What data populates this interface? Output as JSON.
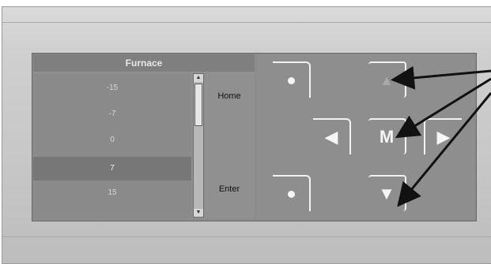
{
  "screen": {
    "title": "Furnace",
    "values": [
      "-15",
      "-7",
      "0",
      "7",
      "15"
    ],
    "selected_index": 3
  },
  "softkeys": {
    "top_label": "Home",
    "bottom_label": "Enter"
  },
  "keypad": {
    "menu_label": "M",
    "left_label": "◀",
    "right_label": "▶",
    "up_label": "▲",
    "down_label": "▼"
  },
  "colors": {
    "bezel": "#cfcfcf",
    "screen": "#909090",
    "selected_row": "#777777",
    "key_outline": "#f2f2f2",
    "callout_arrow": "#111111"
  }
}
